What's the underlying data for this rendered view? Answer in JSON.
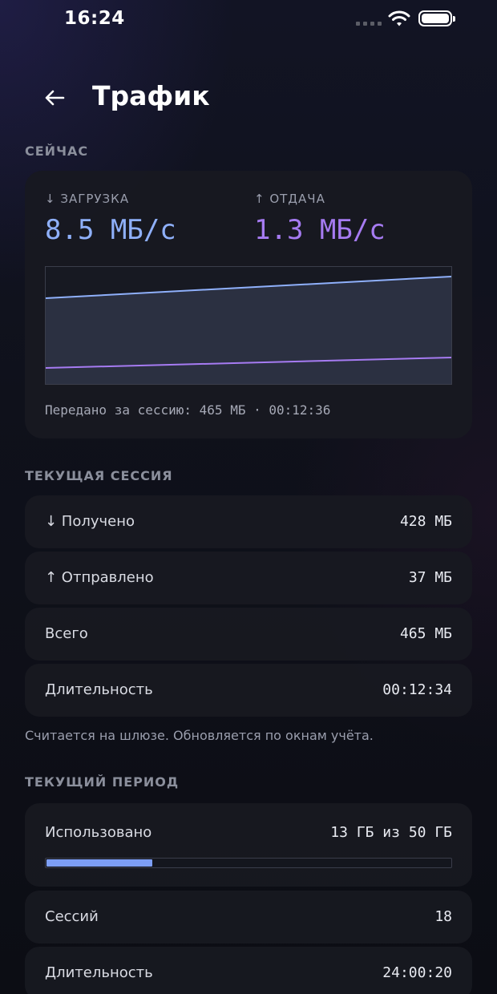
{
  "status_bar": {
    "time": "16:24"
  },
  "header": {
    "title": "Трафик"
  },
  "now": {
    "section_label": "СЕЙЧАС",
    "download": {
      "label": "↓ ЗАГРУЗКА",
      "value": "8.5 МБ/с",
      "color": "#8fb0fb"
    },
    "upload": {
      "label": "↑ ОТДАЧА",
      "value": "1.3 МБ/с",
      "color": "#a67bf2"
    },
    "session_transfer": "Передано за сессию: 465 МБ · 00:12:36"
  },
  "current_session": {
    "section_label": "ТЕКУЩАЯ СЕССИЯ",
    "rows": [
      {
        "label": "↓ Получено",
        "value": "428 МБ"
      },
      {
        "label": "↑ Отправлено",
        "value": "37 МБ"
      },
      {
        "label": "Всего",
        "value": "465 МБ"
      },
      {
        "label": "Длительность",
        "value": "00:12:34"
      }
    ],
    "note": "Считается на шлюзе. Обновляется по окнам учёта."
  },
  "current_period": {
    "section_label": "ТЕКУЩИЙ ПЕРИОД",
    "used_label": "Использовано",
    "used_value": "13 ГБ из 50 ГБ",
    "used_fraction": 0.26,
    "rows": [
      {
        "label": "Сессий",
        "value": "18"
      },
      {
        "label": "Длительность",
        "value": "24:00:20"
      }
    ]
  },
  "colors": {
    "accent_download": "#8fb0fb",
    "accent_upload": "#a67bf2",
    "progress": "#7d9ef5"
  }
}
